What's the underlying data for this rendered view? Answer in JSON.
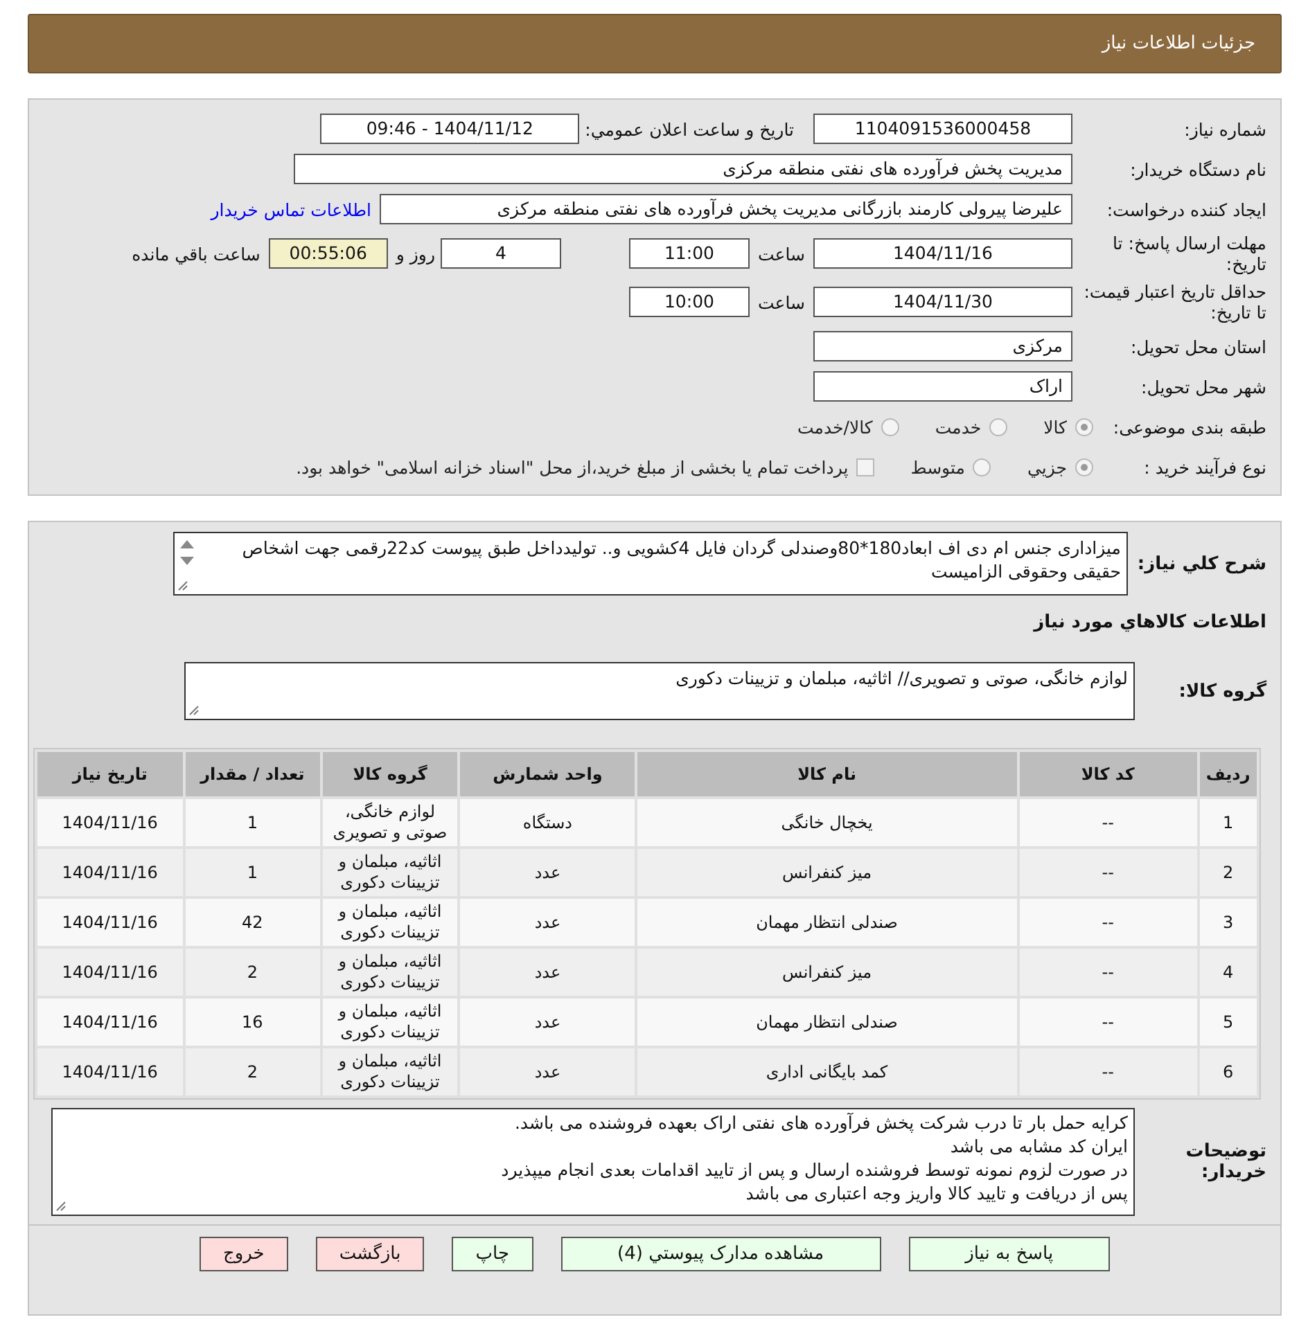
{
  "header": {
    "title": "جزئیات اطلاعات نیاز"
  },
  "form": {
    "need_number": {
      "label": "شماره نیاز:",
      "value": "1104091536000458"
    },
    "announce": {
      "label": "تاریخ و ساعت اعلان عمومي:",
      "value": "1404/11/12 - 09:46"
    },
    "buyer": {
      "label": "نام دستگاه خریدار:",
      "value": "مدیریت پخش فرآورده های نفتی منطقه مرکزی"
    },
    "creator": {
      "label": "ایجاد کننده درخواست:",
      "value": "علیرضا پیرولی کارمند بازرگانی مدیریت پخش فرآورده های نفتی منطقه مرکزی",
      "link": "اطلاعات تماس خریدار"
    },
    "deadline": {
      "label": "مهلت ارسال پاسخ: تا تاریخ:",
      "date": "1404/11/16",
      "time_label": "ساعت",
      "time": "11:00",
      "days": "4",
      "days_label": "روز و",
      "remaining": "00:55:06",
      "remaining_label": "ساعت باقي مانده"
    },
    "validity": {
      "label": "حداقل تاریخ اعتبار قیمت: تا تاریخ:",
      "date": "1404/11/30",
      "time_label": "ساعت",
      "time": "10:00"
    },
    "province": {
      "label": "استان محل تحویل:",
      "value": "مرکزی"
    },
    "city": {
      "label": "شهر محل تحویل:",
      "value": "اراک"
    },
    "category": {
      "label": "طبقه بندی موضوعی:",
      "options": [
        {
          "label": "کالا",
          "selected": true
        },
        {
          "label": "خدمت",
          "selected": false
        },
        {
          "label": "کالا/خدمت",
          "selected": false
        }
      ]
    },
    "process": {
      "label": "نوع فرآیند خرید :",
      "options": [
        {
          "label": "جزيي",
          "selected": true
        },
        {
          "label": "متوسط",
          "selected": false
        }
      ],
      "treasury": {
        "label": "پرداخت تمام یا بخشی از مبلغ خرید،از محل \"اسناد خزانه اسلامی\" خواهد بود.",
        "checked": false
      }
    }
  },
  "details": {
    "description": {
      "label": "شرح کلي نیاز:",
      "value": "میزاداری جنس ام دی اف ابعاد180*80وصندلی گردان فایل 4کشویی و.. تولیدداخل طبق پیوست کد22رقمی  جهت اشخاص حقیقی وحقوقی الزامیست"
    },
    "section_title": "اطلاعات کالاهاي مورد نیاز",
    "goods_group": {
      "label": "گروه کالا:",
      "value": "لوازم خانگی، صوتی و تصویری// اثاثیه، مبلمان و تزیینات دکوری"
    },
    "table": {
      "columns": [
        "ردیف",
        "کد کالا",
        "نام کالا",
        "واحد شمارش",
        "گروه کالا",
        "تعداد / مقدار",
        "تاریخ نیاز"
      ],
      "rows": [
        [
          "1",
          "--",
          "یخچال خانگی",
          "دستگاه",
          "لوازم خانگی، صوتی و تصویری",
          "1",
          "1404/11/16"
        ],
        [
          "2",
          "--",
          "میز کنفرانس",
          "عدد",
          "اثاثیه، مبلمان و تزیینات دکوری",
          "1",
          "1404/11/16"
        ],
        [
          "3",
          "--",
          "صندلی انتظار مهمان",
          "عدد",
          "اثاثیه، مبلمان و تزیینات دکوری",
          "42",
          "1404/11/16"
        ],
        [
          "4",
          "--",
          "میز کنفرانس",
          "عدد",
          "اثاثیه، مبلمان و تزیینات دکوری",
          "2",
          "1404/11/16"
        ],
        [
          "5",
          "--",
          "صندلی انتظار مهمان",
          "عدد",
          "اثاثیه، مبلمان و تزیینات دکوری",
          "16",
          "1404/11/16"
        ],
        [
          "6",
          "--",
          "کمد بایگانی اداری",
          "عدد",
          "اثاثیه، مبلمان و تزیینات دکوری",
          "2",
          "1404/11/16"
        ]
      ]
    },
    "notes": {
      "label": "توضیحات خریدار:",
      "lines": [
        "کرایه حمل بار تا درب شرکت  پخش فرآورده های نفتی اراک بعهده فروشنده می باشد.",
        "ایران کد مشابه می باشد",
        "در صورت لزوم نمونه توسط فروشنده ارسال و پس از تایید اقدامات بعدی انجام میپذیرد",
        "پس از دریافت و تایید کالا واریز وجه اعتباری می باشد"
      ]
    }
  },
  "buttons": [
    {
      "label": "پاسخ به نیاز",
      "kind": "primary"
    },
    {
      "label": "مشاهده مدارک پیوستي (4)",
      "kind": "primary"
    },
    {
      "label": "چاپ",
      "kind": "primary"
    },
    {
      "label": "بازگشت",
      "kind": "danger"
    },
    {
      "label": "خروج",
      "kind": "danger"
    }
  ]
}
